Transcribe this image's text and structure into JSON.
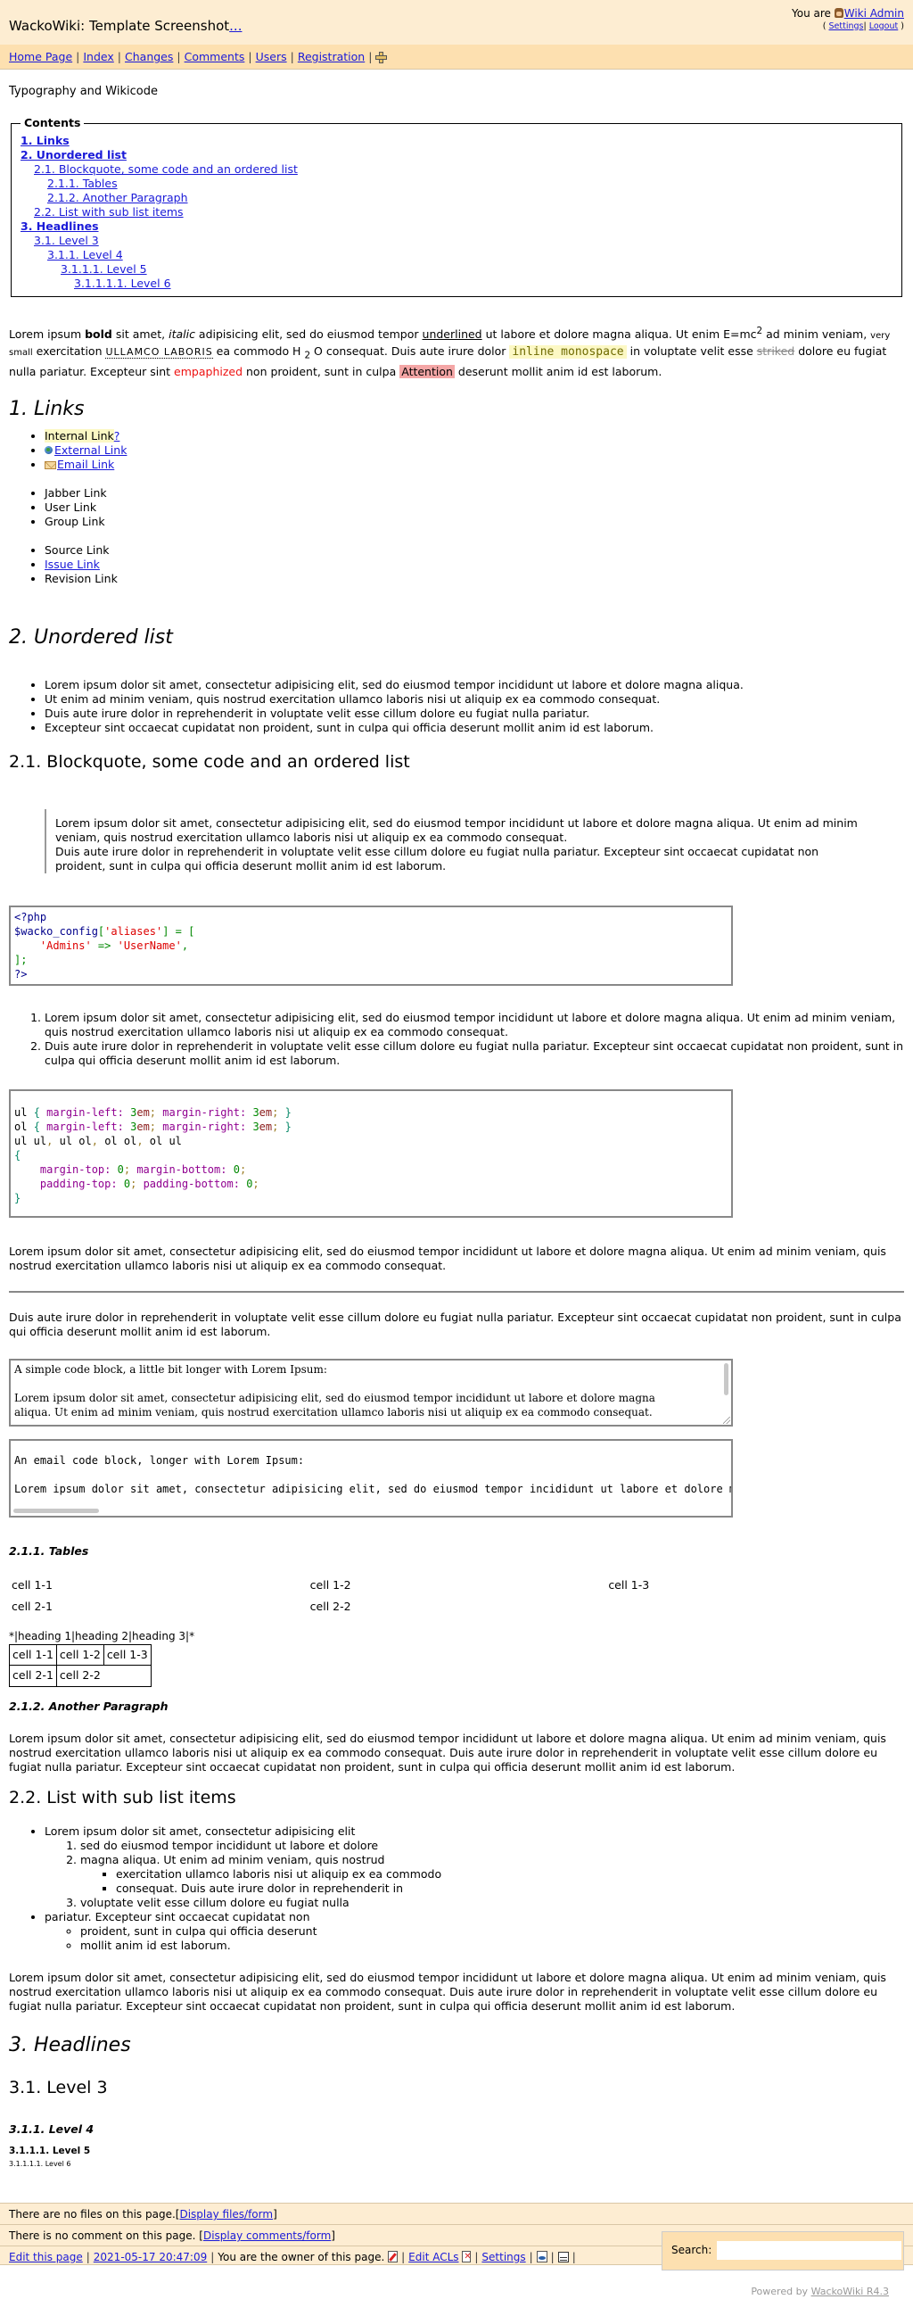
{
  "header": {
    "site_title": "WackoWiki: Template Screenshot",
    "title_link": "...",
    "you_are": "You are",
    "user_name": "Wiki Admin",
    "settings_label": "Settings",
    "logout_label": "Logout",
    "open_paren": "(",
    "close_paren": ")",
    "pipe": "|"
  },
  "nav": {
    "items": [
      "Home Page",
      "Index",
      "Changes",
      "Comments",
      "Users",
      "Registration"
    ],
    "separator": "|"
  },
  "page": {
    "subtitle": "Typography and Wikicode"
  },
  "toc": {
    "legend": "Contents",
    "items": [
      {
        "label": "1. Links",
        "level": 1
      },
      {
        "label": "2. Unordered list",
        "level": 1
      },
      {
        "label": "2.1. Blockquote, some code and an ordered list",
        "level": 2
      },
      {
        "label": "2.1.1. Tables",
        "level": 3
      },
      {
        "label": "2.1.2. Another Paragraph",
        "level": 3
      },
      {
        "label": "2.2. List with sub list items",
        "level": 2
      },
      {
        "label": "3. Headlines",
        "level": 1
      },
      {
        "label": "3.1. Level 3",
        "level": 2
      },
      {
        "label": "3.1.1. Level 4",
        "level": 3
      },
      {
        "label": "3.1.1.1. Level 5",
        "level": 4
      },
      {
        "label": "3.1.1.1.1. Level 6",
        "level": 5
      }
    ]
  },
  "typography": {
    "t1": "Lorem ipsum ",
    "bold": "bold",
    "t2": " sit amet, ",
    "italic": "italic",
    "t3": " adipisicing elit, sed do eiusmod tempor ",
    "underlined": "underlined",
    "t4": " ut labore et dolore magna aliqua. Ut enim E=mc",
    "sup": "2",
    "t5": " ad minim veniam, ",
    "very_small": "very small",
    "t6": " exercitation ",
    "acronym": "ULLAMCO LABORIS",
    "t7": " ea commodo H ",
    "sub": "2",
    "t8": " O consequat. Duis aute irure dolor ",
    "inline_mono": "inline monospace",
    "t9": " in voluptate velit esse ",
    "striked": "striked",
    "t10": " dolore eu fugiat nulla pariatur. Excepteur sint ",
    "emph": "empaphized",
    "t11": " non proident, sunt in culpa ",
    "attention": "Attention",
    "t12": " deserunt mollit anim id est laborum."
  },
  "sections": {
    "links": {
      "heading": "1. Links",
      "internal_link": "Internal Link",
      "internal_q": "?",
      "external_link": "External Link",
      "email_link": "Email Link",
      "group2": [
        "Jabber Link",
        "User Link",
        "Group Link"
      ],
      "source_link": "Source Link",
      "issue_link": "Issue Link",
      "revision_link": "Revision Link"
    },
    "unordered": {
      "heading": "2. Unordered list",
      "items": [
        "Lorem ipsum dolor sit amet, consectetur adipisicing elit, sed do eiusmod tempor incididunt ut labore et dolore magna aliqua.",
        "Ut enim ad minim veniam, quis nostrud exercitation ullamco laboris nisi ut aliquip ex ea commodo consequat.",
        "Duis aute irure dolor in reprehenderit in voluptate velit esse cillum dolore eu fugiat nulla pariatur.",
        "Excepteur sint occaecat cupidatat non proident, sunt in culpa qui officia deserunt mollit anim id est laborum."
      ]
    },
    "blockquote": {
      "heading": "2.1. Blockquote, some code and an ordered list",
      "line1": "Lorem ipsum dolor sit amet, consectetur adipisicing elit, sed do eiusmod tempor incididunt ut labore et dolore magna aliqua. Ut enim ad minim veniam, quis nostrud exercitation ullamco laboris nisi ut aliquip ex ea commodo consequat.",
      "line2": "Duis aute irure dolor in reprehenderit in voluptate velit esse cillum dolore eu fugiat nulla pariatur. Excepteur sint occaecat cupidatat non proident, sunt in culpa qui officia deserunt mollit anim id est laborum."
    },
    "php_code": {
      "open_tag": "<?php",
      "var": "$wacko_config",
      "bracket_open": "[",
      "key": "'aliases'",
      "bracket_close": "]",
      "assign": " = [",
      "indent": "    ",
      "k2": "'Admins'",
      "arrow": " => ",
      "v2": "'UserName'",
      "comma": ",",
      "close_arr": "];",
      "close_tag": "?>"
    },
    "ordered": {
      "items": [
        "Lorem ipsum dolor sit amet, consectetur adipisicing elit, sed do eiusmod tempor incididunt ut labore et dolore magna aliqua. Ut enim ad minim veniam, quis nostrud exercitation ullamco laboris nisi ut aliquip ex ea commodo consequat.",
        "Duis aute irure dolor in reprehenderit in voluptate velit esse cillum dolore eu fugiat nulla pariatur. Excepteur sint occaecat cupidatat non proident, sunt in culpa qui officia deserunt mollit anim id est laborum."
      ]
    },
    "css_code": {
      "ul": "ul",
      "ol": "ol",
      "brace_open": "{",
      "brace_close": "}",
      "ml": "margin-left",
      "mr": "margin-right",
      "colon": ":",
      "semi": ";",
      "val3": "3",
      "unit": "em",
      "selector_parts": [
        "ul ul",
        "ul ol",
        "ol ol",
        "ol ul"
      ],
      "sel_sep": ",",
      "mt": "margin-top",
      "mb": "margin-bottom",
      "pt": "padding-top",
      "pb": "padding-bottom",
      "zero": "0"
    },
    "paragraph1": "Lorem ipsum dolor sit amet, consectetur adipisicing elit, sed do eiusmod tempor incididunt ut labore et dolore magna aliqua. Ut enim ad minim veniam, quis nostrud exercitation ullamco laboris nisi ut aliquip ex ea commodo consequat.",
    "paragraph2": "Duis aute irure dolor in reprehenderit in voluptate velit esse cillum dolore eu fugiat nulla pariatur. Excepteur sint occaecat cupidatat non proident, sunt in culpa qui officia deserunt mollit anim id est laborum.",
    "simple_code": {
      "line1": "A simple code block, a little bit longer with Lorem Ipsum:",
      "line2": "Lorem ipsum dolor sit amet, consectetur adipisicing elit, sed do eiusmod tempor incididunt ut labore et dolore magna",
      "line3": "aliqua. Ut enim ad minim veniam, quis nostrud exercitation ullamco laboris nisi ut aliquip ex ea commodo consequat."
    },
    "email_code": {
      "line1": "An email code block, longer with Lorem Ipsum:",
      "line2": "Lorem ipsum dolor sit amet, consectetur adipisicing elit, sed do eiusmod tempor incididunt ut labore et dolore magna aliqua."
    },
    "tables": {
      "heading": "2.1.1. Tables",
      "plain_rows": [
        [
          "cell 1-1",
          "cell 1-2",
          "cell 1-3"
        ],
        [
          "cell 2-1",
          "cell 2-2",
          ""
        ]
      ],
      "raw_heading_line": "*|heading 1|heading 2|heading 3|*",
      "bordered_rows": [
        [
          "cell 1-1",
          "cell 1-2",
          "cell 1-3"
        ],
        [
          "cell 2-1",
          "cell 2-2"
        ]
      ]
    },
    "another_paragraph": {
      "heading": "2.1.2. Another Paragraph",
      "text": "Lorem ipsum dolor sit amet, consectetur adipisicing elit, sed do eiusmod tempor incididunt ut labore et dolore magna aliqua. Ut enim ad minim veniam, quis nostrud exercitation ullamco laboris nisi ut aliquip ex ea commodo consequat. Duis aute irure dolor in reprehenderit in voluptate velit esse cillum dolore eu fugiat nulla pariatur. Excepteur sint occaecat cupidatat non proident, sunt in culpa qui officia deserunt mollit anim id est laborum."
    },
    "sublist": {
      "heading": "2.2. List with sub list items",
      "item1": "Lorem ipsum dolor sit amet, consectetur adipisicing elit",
      "item1_sub": [
        "sed do eiusmod tempor incididunt ut labore et dolore",
        "magna aliqua. Ut enim ad minim veniam, quis nostrud",
        "voluptate velit esse cillum dolore eu fugiat nulla"
      ],
      "item1_sub2_sub": [
        "exercitation ullamco laboris nisi ut aliquip ex ea commodo",
        "consequat. Duis aute irure dolor in reprehenderit in"
      ],
      "item2": "pariatur. Excepteur sint occaecat cupidatat non",
      "item2_sub": [
        "proident, sunt in culpa qui officia deserunt",
        "mollit anim id est laborum."
      ],
      "after_text": "Lorem ipsum dolor sit amet, consectetur adipisicing elit, sed do eiusmod tempor incididunt ut labore et dolore magna aliqua. Ut enim ad minim veniam, quis nostrud exercitation ullamco laboris nisi ut aliquip ex ea commodo consequat. Duis aute irure dolor in reprehenderit in voluptate velit esse cillum dolore eu fugiat nulla pariatur. Excepteur sint occaecat cupidatat non proident, sunt in culpa qui officia deserunt mollit anim id est laborum."
    },
    "headlines": {
      "h1": "3. Headlines",
      "h2": "3.1. Level 3",
      "h3": "3.1.1. Level 4",
      "h4": "3.1.1.1. Level 5",
      "h5": "3.1.1.1.1. Level 6"
    }
  },
  "footer": {
    "files_text": "There are no files on this page.",
    "files_link": "Display files/form",
    "comments_text": "There is no comment on this page.",
    "comments_link": "Display comments/form",
    "bracket_open": "[",
    "bracket_close": "]",
    "edit_page": "Edit this page",
    "timestamp": "2021-05-17 20:47:09",
    "owner_text": "You are the owner of this page.",
    "edit_acls": "Edit ACLs",
    "settings": "Settings",
    "separator": "|",
    "search_label": "Search:",
    "search_value": "",
    "powered_by": "Powered by",
    "powered_link": "WackoWiki R4.3"
  }
}
